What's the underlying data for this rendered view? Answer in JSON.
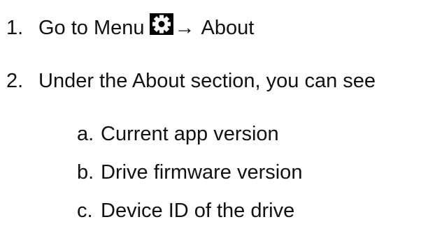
{
  "steps": [
    {
      "number": "1.",
      "text_before_icon": "Go to Menu",
      "icon": "gear-icon",
      "arrow": "→",
      "text_after_icon": "About"
    },
    {
      "number": "2.",
      "text": "Under the About section, you can see",
      "substeps": [
        {
          "letter": "a.",
          "text": "Current app version"
        },
        {
          "letter": "b.",
          "text": "Drive firmware version"
        },
        {
          "letter": "c.",
          "text": "Device ID of the drive"
        }
      ]
    }
  ],
  "colors": {
    "text": "#111111",
    "icon_background": "#000000",
    "icon_foreground": "#ffffff"
  }
}
